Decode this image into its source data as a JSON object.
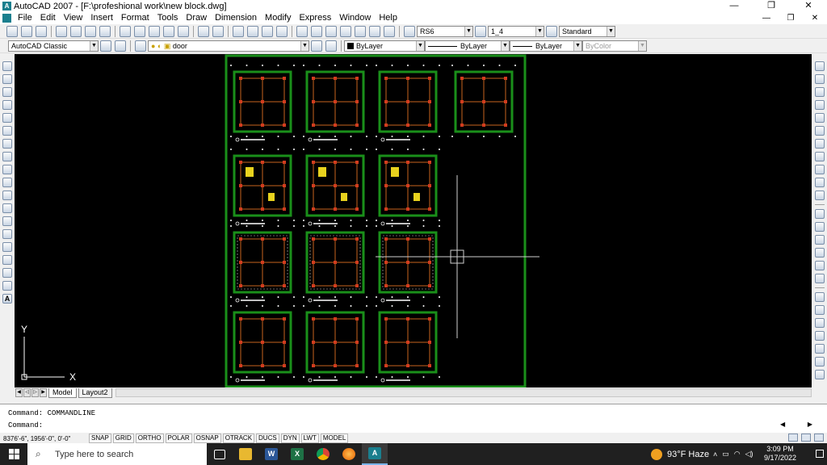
{
  "window": {
    "title": "AutoCAD 2007 - [F:\\profeshional work\\new block.dwg]",
    "minimize": "—",
    "maximize": "❐",
    "close": "✕"
  },
  "menu": {
    "items": [
      "File",
      "Edit",
      "View",
      "Insert",
      "Format",
      "Tools",
      "Draw",
      "Dimension",
      "Modify",
      "Express",
      "Window",
      "Help"
    ],
    "doc_minimize": "—",
    "doc_restore": "❐",
    "doc_close": "✕"
  },
  "toolbar1": {
    "text_style": "RS6",
    "dim_style": "1_4",
    "table_style": "Standard"
  },
  "toolbar2": {
    "workspace": "AutoCAD Classic",
    "layer": "door",
    "color": "ByLayer",
    "linetype": "ByLayer",
    "lineweight": "ByLayer",
    "plotstyle": "ByColor"
  },
  "canvas": {
    "ucs_x": "X",
    "ucs_y": "Y"
  },
  "tabs": {
    "items": [
      "Model",
      "Layout2"
    ],
    "active": "Model"
  },
  "command": {
    "history": "Command: COMMANDLINE",
    "prompt": "Command:",
    "input_value": ""
  },
  "status": {
    "coordinates": "8376'-6\", 1956'-0\", 0'-0\"",
    "toggles": [
      "SNAP",
      "GRID",
      "ORTHO",
      "POLAR",
      "OSNAP",
      "OTRACK",
      "DUCS",
      "DYN",
      "LWT",
      "MODEL"
    ]
  },
  "taskbar": {
    "search_placeholder": "Type here to search",
    "weather": "93°F Haze",
    "time": "3:09 PM",
    "date": "9/17/2022",
    "apps": [
      "task-view",
      "file-explorer",
      "word",
      "excel",
      "chrome",
      "firefox",
      "autocad"
    ]
  },
  "colors": {
    "canvas_bg": "#000000",
    "frame_green": "#1a8f1a",
    "wall_orange": "#c8641e",
    "column_red": "#d23c1e",
    "accent_yellow": "#e8d21e",
    "crosshair": "#cfcfcf"
  }
}
